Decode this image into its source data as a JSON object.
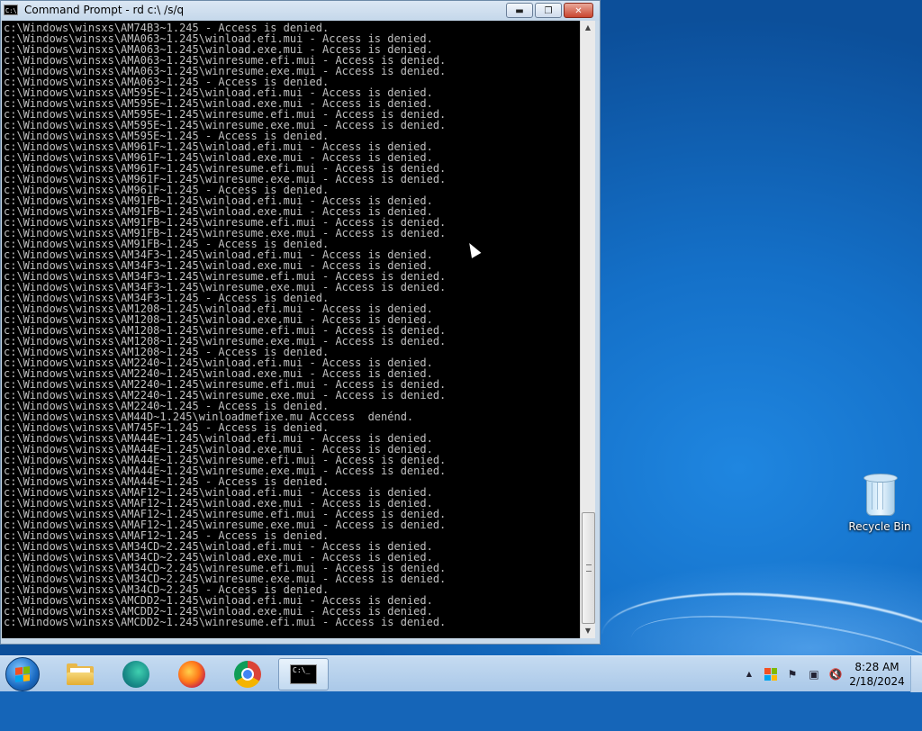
{
  "window": {
    "title": "Command Prompt - rd  c:\\ /s/q",
    "icon": "cmd-icon",
    "minimize_glyph": "▬",
    "maximize_glyph": "❐",
    "close_glyph": "✕"
  },
  "console": {
    "lines": [
      "c:\\Windows\\winsxs\\AM74B3~1.245 - Access is denied.",
      "c:\\Windows\\winsxs\\AMA063~1.245\\winload.efi.mui - Access is denied.",
      "c:\\Windows\\winsxs\\AMA063~1.245\\winload.exe.mui - Access is denied.",
      "c:\\Windows\\winsxs\\AMA063~1.245\\winresume.efi.mui - Access is denied.",
      "c:\\Windows\\winsxs\\AMA063~1.245\\winresume.exe.mui - Access is denied.",
      "c:\\Windows\\winsxs\\AMA063~1.245 - Access is denied.",
      "c:\\Windows\\winsxs\\AM595E~1.245\\winload.efi.mui - Access is denied.",
      "c:\\Windows\\winsxs\\AM595E~1.245\\winload.exe.mui - Access is denied.",
      "c:\\Windows\\winsxs\\AM595E~1.245\\winresume.efi.mui - Access is denied.",
      "c:\\Windows\\winsxs\\AM595E~1.245\\winresume.exe.mui - Access is denied.",
      "c:\\Windows\\winsxs\\AM595E~1.245 - Access is denied.",
      "c:\\Windows\\winsxs\\AM961F~1.245\\winload.efi.mui - Access is denied.",
      "c:\\Windows\\winsxs\\AM961F~1.245\\winload.exe.mui - Access is denied.",
      "c:\\Windows\\winsxs\\AM961F~1.245\\winresume.efi.mui - Access is denied.",
      "c:\\Windows\\winsxs\\AM961F~1.245\\winresume.exe.mui - Access is denied.",
      "c:\\Windows\\winsxs\\AM961F~1.245 - Access is denied.",
      "c:\\Windows\\winsxs\\AM91FB~1.245\\winload.efi.mui - Access is denied.",
      "c:\\Windows\\winsxs\\AM91FB~1.245\\winload.exe.mui - Access is denied.",
      "c:\\Windows\\winsxs\\AM91FB~1.245\\winresume.efi.mui - Access is denied.",
      "c:\\Windows\\winsxs\\AM91FB~1.245\\winresume.exe.mui - Access is denied.",
      "c:\\Windows\\winsxs\\AM91FB~1.245 - Access is denied.",
      "c:\\Windows\\winsxs\\AM34F3~1.245\\winload.efi.mui - Access is denied.",
      "c:\\Windows\\winsxs\\AM34F3~1.245\\winload.exe.mui - Access is denied.",
      "c:\\Windows\\winsxs\\AM34F3~1.245\\winresume.efi.mui - Access is denied.",
      "c:\\Windows\\winsxs\\AM34F3~1.245\\winresume.exe.mui - Access is denied.",
      "c:\\Windows\\winsxs\\AM34F3~1.245 - Access is denied.",
      "c:\\Windows\\winsxs\\AM1208~1.245\\winload.efi.mui - Access is denied.",
      "c:\\Windows\\winsxs\\AM1208~1.245\\winload.exe.mui - Access is denied.",
      "c:\\Windows\\winsxs\\AM1208~1.245\\winresume.efi.mui - Access is denied.",
      "c:\\Windows\\winsxs\\AM1208~1.245\\winresume.exe.mui - Access is denied.",
      "c:\\Windows\\winsxs\\AM1208~1.245 - Access is denied.",
      "c:\\Windows\\winsxs\\AM2240~1.245\\winload.efi.mui - Access is denied.",
      "c:\\Windows\\winsxs\\AM2240~1.245\\winload.exe.mui - Access is denied.",
      "c:\\Windows\\winsxs\\AM2240~1.245\\winresume.efi.mui - Access is denied.",
      "c:\\Windows\\winsxs\\AM2240~1.245\\winresume.exe.mui - Access is denied.",
      "c:\\Windows\\winsxs\\AM2240~1.245 - Access is denied.",
      "c:\\Windows\\winsxs\\AM44D~1.245\\winloadmefixe.mu Acccess  denénd.",
      "c:\\Windows\\winsxs\\AM745F~1.245 - Access is denied.",
      "c:\\Windows\\winsxs\\AMA44E~1.245\\winload.efi.mui - Access is denied.",
      "c:\\Windows\\winsxs\\AMA44E~1.245\\winload.exe.mui - Access is denied.",
      "c:\\Windows\\winsxs\\AMA44E~1.245\\winresume.efi.mui - Access is denied.",
      "c:\\Windows\\winsxs\\AMA44E~1.245\\winresume.exe.mui - Access is denied.",
      "c:\\Windows\\winsxs\\AMA44E~1.245 - Access is denied.",
      "c:\\Windows\\winsxs\\AMAF12~1.245\\winload.efi.mui - Access is denied.",
      "c:\\Windows\\winsxs\\AMAF12~1.245\\winload.exe.mui - Access is denied.",
      "c:\\Windows\\winsxs\\AMAF12~1.245\\winresume.efi.mui - Access is denied.",
      "c:\\Windows\\winsxs\\AMAF12~1.245\\winresume.exe.mui - Access is denied.",
      "c:\\Windows\\winsxs\\AMAF12~1.245 - Access is denied.",
      "c:\\Windows\\winsxs\\AM34CD~2.245\\winload.efi.mui - Access is denied.",
      "c:\\Windows\\winsxs\\AM34CD~2.245\\winload.exe.mui - Access is denied.",
      "c:\\Windows\\winsxs\\AM34CD~2.245\\winresume.efi.mui - Access is denied.",
      "c:\\Windows\\winsxs\\AM34CD~2.245\\winresume.exe.mui - Access is denied.",
      "c:\\Windows\\winsxs\\AM34CD~2.245 - Access is denied.",
      "c:\\Windows\\winsxs\\AMCDD2~1.245\\winload.efi.mui - Access is denied.",
      "c:\\Windows\\winsxs\\AMCDD2~1.245\\winload.exe.mui - Access is denied.",
      "c:\\Windows\\winsxs\\AMCDD2~1.245\\winresume.efi.mui - Access is denied."
    ]
  },
  "desktop": {
    "recycle_bin_label": "Recycle Bin"
  },
  "taskbar": {
    "pinned": [
      {
        "name": "windows-explorer-icon"
      },
      {
        "name": "edge-icon"
      },
      {
        "name": "firefox-icon"
      },
      {
        "name": "chrome-icon"
      },
      {
        "name": "cmd-icon",
        "active": true
      }
    ],
    "tray": {
      "show_hidden_glyph": "▲",
      "action_center_glyph": "⚑",
      "network_glyph": "▣",
      "volume_glyph": "🔇"
    },
    "clock": {
      "time": "8:28 AM",
      "date": "2/18/2024"
    }
  },
  "colors": {
    "console_bg": "#000000",
    "console_text": "#c0c0c0",
    "desktop_blue": "#1470c8",
    "taskbar": "#b8d0ea"
  }
}
